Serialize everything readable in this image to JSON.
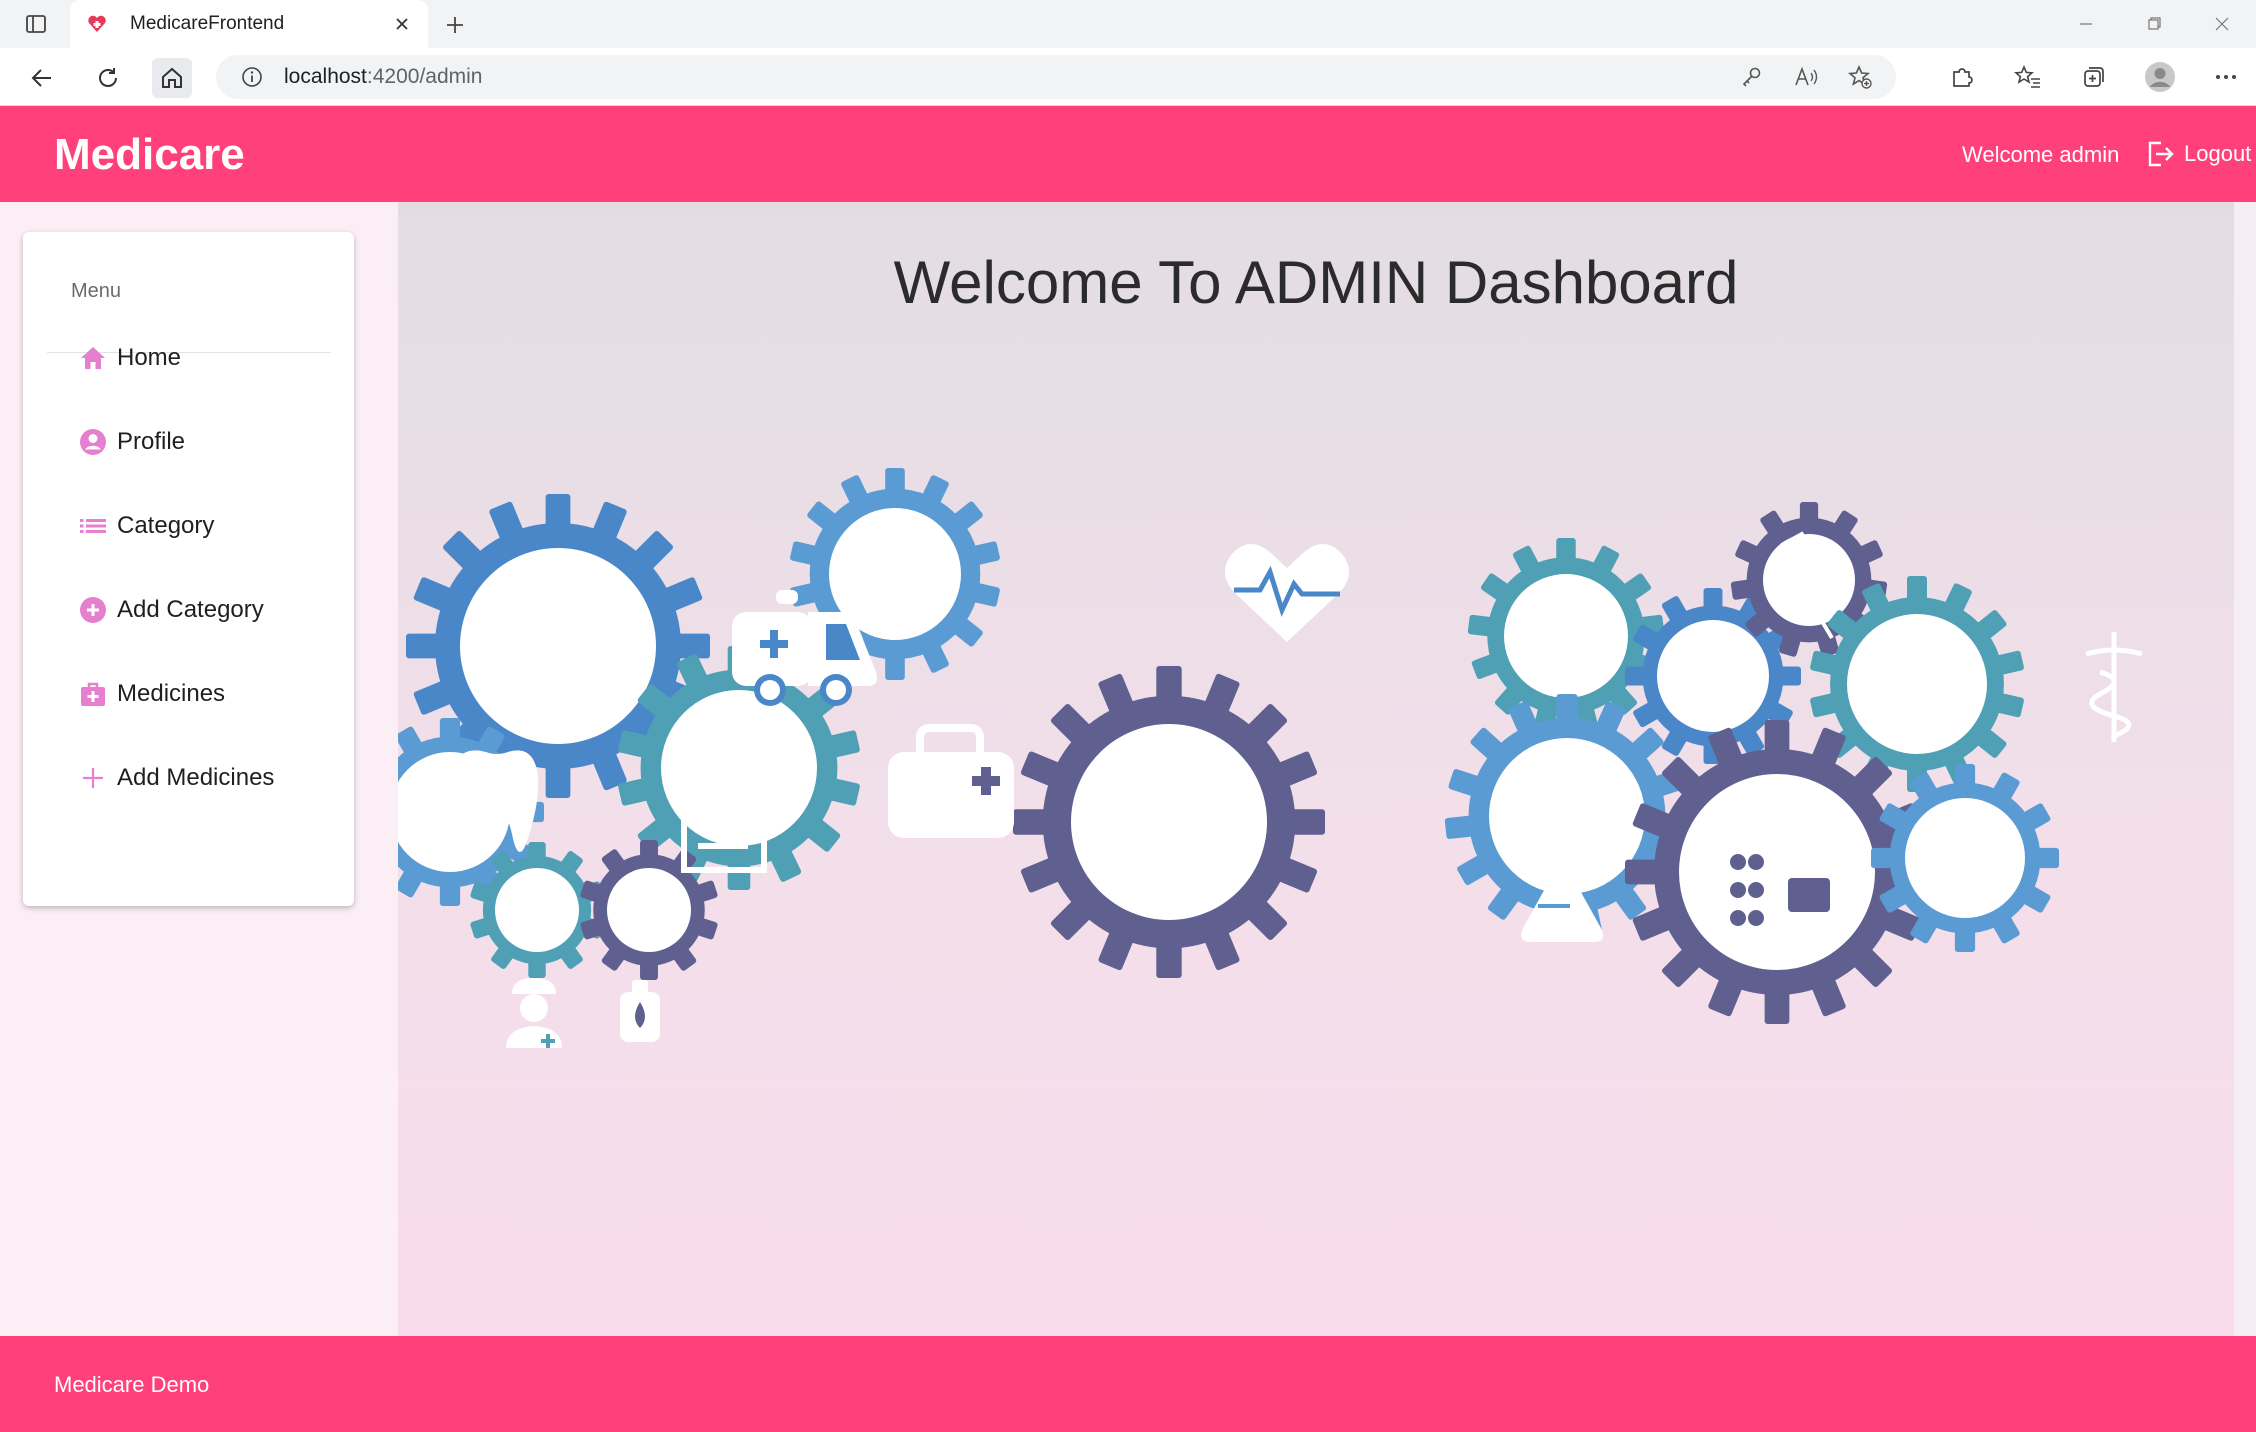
{
  "browser": {
    "tab_title": "MedicareFrontend",
    "url_host": "localhost",
    "url_path": ":4200/admin"
  },
  "header": {
    "brand": "Medicare",
    "welcome": "Welcome admin",
    "logout_label": "Logout"
  },
  "sidebar": {
    "title": "Menu",
    "items": [
      {
        "label": "Home",
        "icon": "home-icon"
      },
      {
        "label": "Profile",
        "icon": "account-circle-icon"
      },
      {
        "label": "Category",
        "icon": "list-icon"
      },
      {
        "label": "Add Category",
        "icon": "add-circle-icon"
      },
      {
        "label": "Medicines",
        "icon": "medical-bag-icon"
      },
      {
        "label": "Add Medicines",
        "icon": "plus-icon"
      }
    ]
  },
  "main": {
    "title": "Welcome To ADMIN Dashboard",
    "illustration": "medical-gears-illustration"
  },
  "footer": {
    "text": "Medicare Demo"
  },
  "colors": {
    "brand": "#ff407b",
    "menu_icon": "#e77fd0",
    "gear_blue": "#4a87c9",
    "gear_teal": "#4fa0b5",
    "gear_slate": "#5f6090",
    "gear_light": "#5b9bd3"
  }
}
